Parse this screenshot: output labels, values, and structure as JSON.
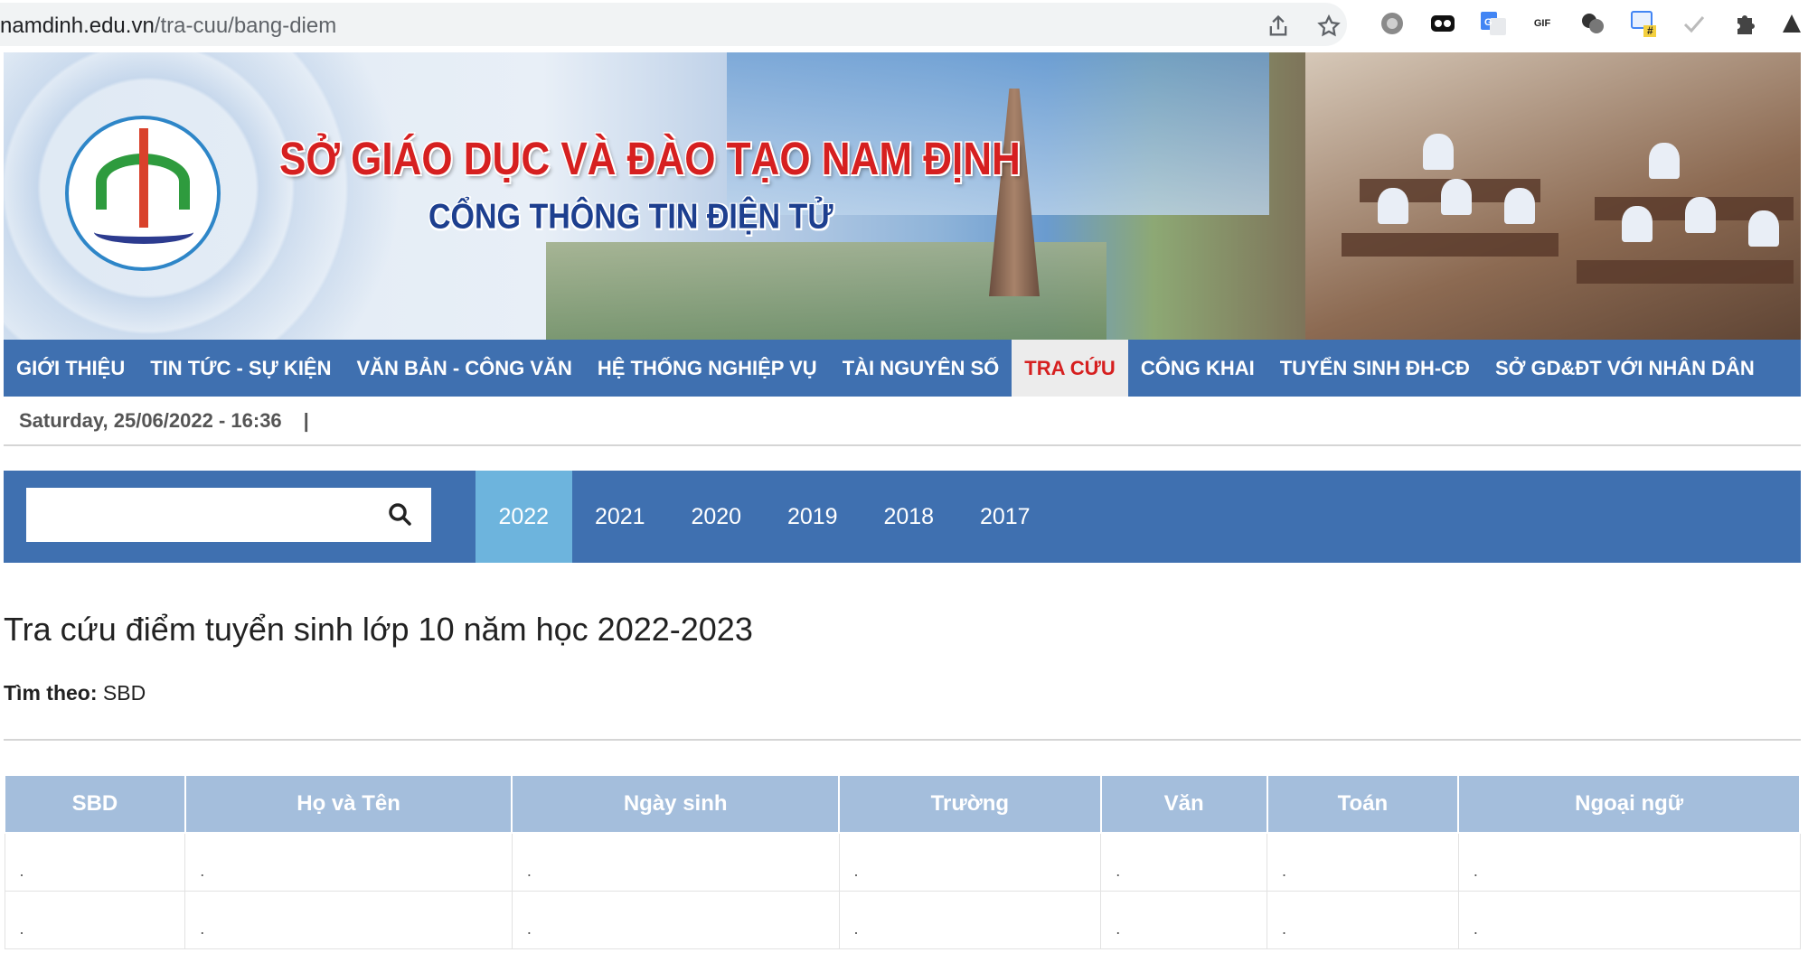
{
  "browser": {
    "url_domain": "namdinh.edu.vn",
    "url_path": "/tra-cuu/bang-diem",
    "extension_gif_label": "GIF",
    "extension_hash_label": "#"
  },
  "banner": {
    "title_main": "SỞ GIÁO DỤC VÀ ĐÀO TẠO NAM ĐỊNH",
    "title_sub": "CỔNG THÔNG TIN ĐIỆN TỬ"
  },
  "nav": {
    "items": [
      {
        "label": "GIỚI THIỆU"
      },
      {
        "label": "TIN TỨC - SỰ KIỆN"
      },
      {
        "label": "VĂN BẢN - CÔNG VĂN"
      },
      {
        "label": "HỆ THỐNG NGHIỆP VỤ"
      },
      {
        "label": "TÀI NGUYÊN SỐ"
      },
      {
        "label": "TRA CỨU"
      },
      {
        "label": "CÔNG KHAI"
      },
      {
        "label": "TUYỂN SINH ĐH-CĐ"
      },
      {
        "label": "SỞ GD&ĐT VỚI NHÂN DÂN"
      }
    ],
    "active_index": 5
  },
  "date_line": {
    "datetime": "Saturday, 25/06/2022 - 16:36",
    "separator": "|"
  },
  "search": {
    "value": "",
    "placeholder": ""
  },
  "years": {
    "items": [
      "2022",
      "2021",
      "2020",
      "2019",
      "2018",
      "2017"
    ],
    "active": "2022"
  },
  "content": {
    "title": "Tra cứu điểm tuyển sinh lớp 10 năm học 2022-2023",
    "search_by_label": "Tìm theo:",
    "search_by_value": "SBD"
  },
  "table": {
    "headers": [
      "SBD",
      "Họ và Tên",
      "Ngày sinh",
      "Trường",
      "Văn",
      "Toán",
      "Ngoại ngữ"
    ],
    "rows": [
      [
        ".",
        ".",
        ".",
        ".",
        ".",
        ".",
        "."
      ],
      [
        ".",
        ".",
        ".",
        ".",
        ".",
        ".",
        "."
      ]
    ]
  },
  "colors": {
    "nav_blue": "#3f70b0",
    "active_red": "#d62020",
    "year_active": "#6db4dd",
    "table_header": "#a4bedc"
  }
}
